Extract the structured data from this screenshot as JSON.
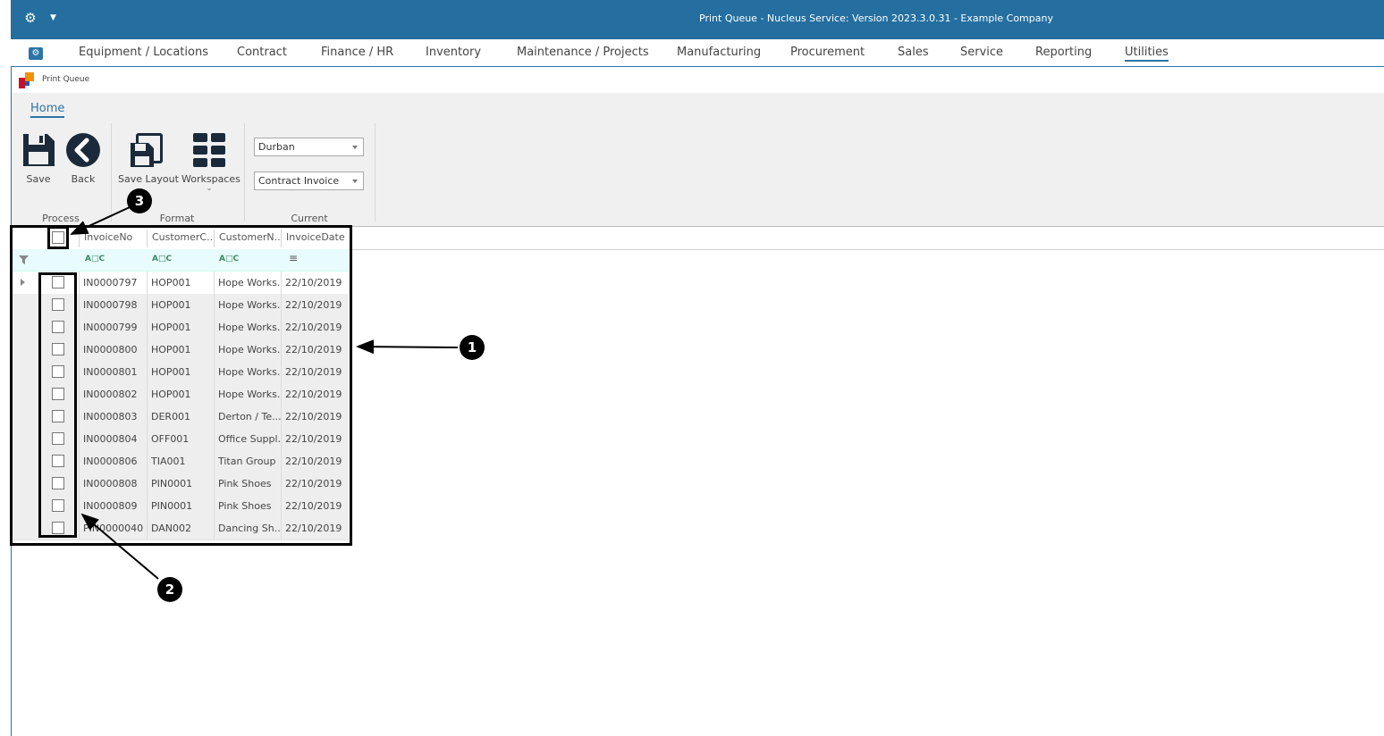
{
  "window": {
    "title": "Print Queue - Nucleus Service: Version 2023.3.0.31 - Example Company"
  },
  "menu": {
    "items": [
      {
        "label": "Equipment / Locations"
      },
      {
        "label": "Contract"
      },
      {
        "label": "Finance / HR"
      },
      {
        "label": "Inventory"
      },
      {
        "label": "Maintenance / Projects"
      },
      {
        "label": "Manufacturing"
      },
      {
        "label": "Procurement"
      },
      {
        "label": "Sales"
      },
      {
        "label": "Service"
      },
      {
        "label": "Reporting"
      },
      {
        "label": "Utilities",
        "active": true
      }
    ]
  },
  "doc_tab": {
    "label": "Print Queue"
  },
  "ribbon": {
    "tab": "Home",
    "buttons": {
      "save": "Save",
      "back": "Back",
      "save_layout": "Save Layout",
      "workspaces": "Workspaces"
    },
    "groups": {
      "process": "Process",
      "format": "Format",
      "current": "Current"
    },
    "current": {
      "branch": "Durban",
      "document_type": "Contract Invoice"
    }
  },
  "grid": {
    "columns": [
      "InvoiceNo",
      "CustomerC...",
      "CustomerN...",
      "InvoiceDate"
    ],
    "rows": [
      {
        "invoice": "IN0000797",
        "code": "HOP001",
        "name": "Hope Works...",
        "date": "22/10/2019"
      },
      {
        "invoice": "IN0000798",
        "code": "HOP001",
        "name": "Hope Works...",
        "date": "22/10/2019"
      },
      {
        "invoice": "IN0000799",
        "code": "HOP001",
        "name": "Hope Works...",
        "date": "22/10/2019"
      },
      {
        "invoice": "IN0000800",
        "code": "HOP001",
        "name": "Hope Works...",
        "date": "22/10/2019"
      },
      {
        "invoice": "IN0000801",
        "code": "HOP001",
        "name": "Hope Works...",
        "date": "22/10/2019"
      },
      {
        "invoice": "IN0000802",
        "code": "HOP001",
        "name": "Hope Works...",
        "date": "22/10/2019"
      },
      {
        "invoice": "IN0000803",
        "code": "DER001",
        "name": "Derton / Te...",
        "date": "22/10/2019"
      },
      {
        "invoice": "IN0000804",
        "code": "OFF001",
        "name": "Office Suppl...",
        "date": "22/10/2019"
      },
      {
        "invoice": "IN0000806",
        "code": "TIA001",
        "name": "Titan Group",
        "date": "22/10/2019"
      },
      {
        "invoice": "IN0000808",
        "code": "PIN0001",
        "name": "Pink Shoes",
        "date": "22/10/2019"
      },
      {
        "invoice": "IN0000809",
        "code": "PIN0001",
        "name": "Pink Shoes",
        "date": "22/10/2019"
      },
      {
        "invoice": "PIN0000040",
        "code": "DAN002",
        "name": "Dancing Sh...",
        "date": "22/10/2019"
      }
    ]
  },
  "annotations": [
    "1",
    "2",
    "3"
  ],
  "colors": {
    "accent": "#246fa0",
    "filter_row": "#e8fbfd"
  }
}
